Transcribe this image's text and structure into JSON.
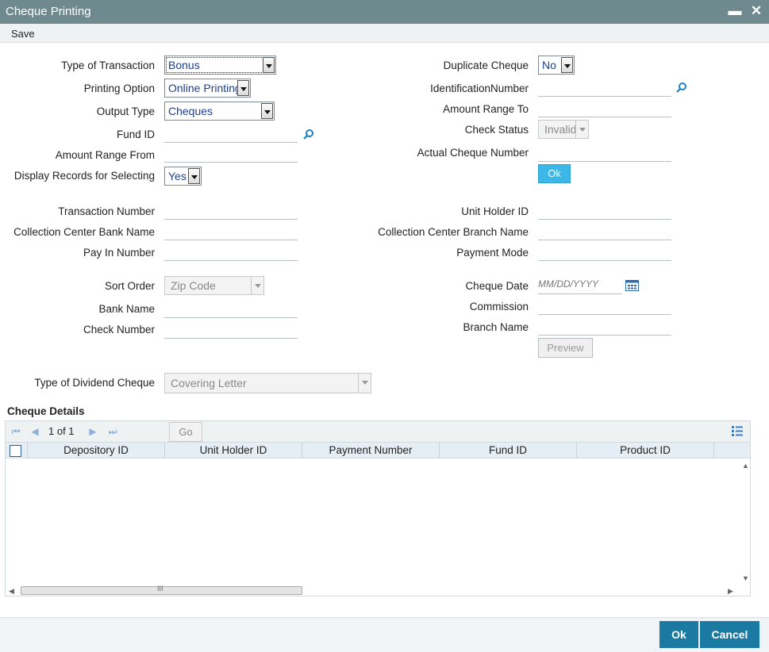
{
  "window": {
    "title": "Cheque Printing",
    "minimize": "▬",
    "close": "✕"
  },
  "menu": {
    "save": "Save"
  },
  "left": {
    "type_of_transaction": {
      "label": "Type of Transaction",
      "value": "Bonus"
    },
    "printing_option": {
      "label": "Printing Option",
      "value": "Online Printing"
    },
    "output_type": {
      "label": "Output Type",
      "value": "Cheques"
    },
    "fund_id": {
      "label": "Fund ID",
      "value": ""
    },
    "amount_range_from": {
      "label": "Amount Range From",
      "value": ""
    },
    "display_records": {
      "label": "Display Records for Selecting",
      "value": "Yes"
    },
    "transaction_number": {
      "label": "Transaction Number",
      "value": ""
    },
    "collection_center_bank_name": {
      "label": "Collection Center Bank Name",
      "value": ""
    },
    "pay_in_number": {
      "label": "Pay In Number",
      "value": ""
    },
    "sort_order": {
      "label": "Sort Order",
      "value": "Zip Code"
    },
    "bank_name": {
      "label": "Bank Name",
      "value": ""
    },
    "check_number": {
      "label": "Check Number",
      "value": ""
    },
    "type_of_dividend_cheque": {
      "label": "Type of Dividend Cheque",
      "value": "Covering Letter"
    }
  },
  "right": {
    "duplicate_cheque": {
      "label": "Duplicate Cheque",
      "value": "No"
    },
    "identification_number": {
      "label": "IdentificationNumber",
      "value": ""
    },
    "amount_range_to": {
      "label": "Amount Range To",
      "value": ""
    },
    "check_status": {
      "label": "Check Status",
      "value": "Invalid"
    },
    "actual_cheque_number": {
      "label": "Actual Cheque Number",
      "value": ""
    },
    "ok_button": "Ok",
    "unit_holder_id": {
      "label": "Unit Holder ID",
      "value": ""
    },
    "collection_center_branch_name": {
      "label": "Collection Center Branch Name",
      "value": ""
    },
    "payment_mode": {
      "label": "Payment Mode",
      "value": ""
    },
    "cheque_date": {
      "label": "Cheque Date",
      "placeholder": "MM/DD/YYYY"
    },
    "commission": {
      "label": "Commission",
      "value": ""
    },
    "branch_name": {
      "label": "Branch Name",
      "value": ""
    },
    "preview_button": "Preview"
  },
  "cheque_details": {
    "title": "Cheque Details",
    "pagination": {
      "text": "1 of 1"
    },
    "go_button": "Go",
    "columns": [
      "Depository ID",
      "Unit Holder ID",
      "Payment Number",
      "Fund ID",
      "Product ID"
    ],
    "rows": [],
    "scroll_grip": "III"
  },
  "footer": {
    "ok": "Ok",
    "cancel": "Cancel"
  },
  "colors": {
    "titlebar": "#6e8a8f",
    "accent": "#3bb7e8",
    "footer_button": "#1b7aa1"
  }
}
